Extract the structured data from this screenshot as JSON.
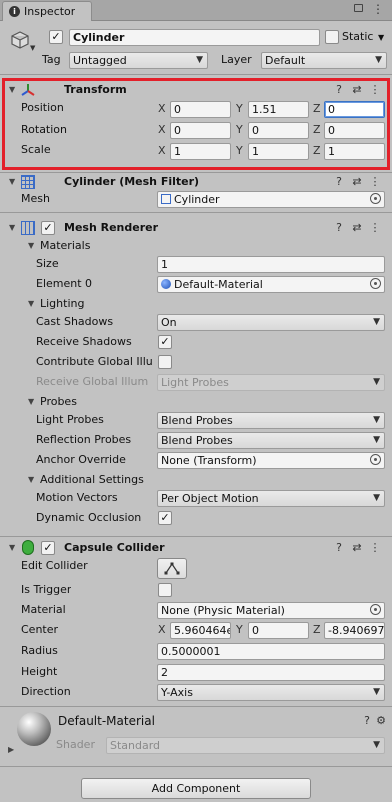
{
  "tab": {
    "title": "Inspector"
  },
  "object": {
    "name": "Cylinder",
    "static_label": "Static",
    "tag_label": "Tag",
    "tag_value": "Untagged",
    "layer_label": "Layer",
    "layer_value": "Default"
  },
  "transform": {
    "title": "Transform",
    "rows": [
      {
        "label": "Position",
        "x": "0",
        "y": "1.51",
        "z": "0"
      },
      {
        "label": "Rotation",
        "x": "0",
        "y": "0",
        "z": "0"
      },
      {
        "label": "Scale",
        "x": "1",
        "y": "1",
        "z": "1"
      }
    ],
    "axes": [
      "X",
      "Y",
      "Z"
    ]
  },
  "mesh_filter": {
    "title": "Cylinder (Mesh Filter)",
    "mesh_label": "Mesh",
    "mesh_value": "Cylinder"
  },
  "mesh_renderer": {
    "title": "Mesh Renderer",
    "materials_label": "Materials",
    "size_label": "Size",
    "size_value": "1",
    "element0_label": "Element 0",
    "element0_value": "Default-Material",
    "lighting_label": "Lighting",
    "cast_shadows_label": "Cast Shadows",
    "cast_shadows_value": "On",
    "receive_shadows_label": "Receive Shadows",
    "contribute_gi_label": "Contribute Global Illu",
    "receive_gi_label": "Receive Global Illum",
    "receive_gi_value": "Light Probes",
    "probes_label": "Probes",
    "light_probes_label": "Light Probes",
    "light_probes_value": "Blend Probes",
    "reflection_probes_label": "Reflection Probes",
    "reflection_probes_value": "Blend Probes",
    "anchor_override_label": "Anchor Override",
    "anchor_override_value": "None (Transform)",
    "additional_label": "Additional Settings",
    "motion_vectors_label": "Motion Vectors",
    "motion_vectors_value": "Per Object Motion",
    "dynamic_occlusion_label": "Dynamic Occlusion"
  },
  "capsule_collider": {
    "title": "Capsule Collider",
    "edit_collider_label": "Edit Collider",
    "is_trigger_label": "Is Trigger",
    "material_label": "Material",
    "material_value": "None (Physic Material)",
    "center_label": "Center",
    "center_x": "5.960464e",
    "center_y": "0",
    "center_z": "-8.940697",
    "radius_label": "Radius",
    "radius_value": "0.5000001",
    "height_label": "Height",
    "height_value": "2",
    "direction_label": "Direction",
    "direction_value": "Y-Axis"
  },
  "material": {
    "name": "Default-Material",
    "shader_label": "Shader",
    "shader_value": "Standard"
  },
  "add_component_label": "Add Component",
  "colors": {
    "highlight": "#e3202a",
    "focus": "#3a72c4",
    "panel": "#c2c2c2"
  }
}
